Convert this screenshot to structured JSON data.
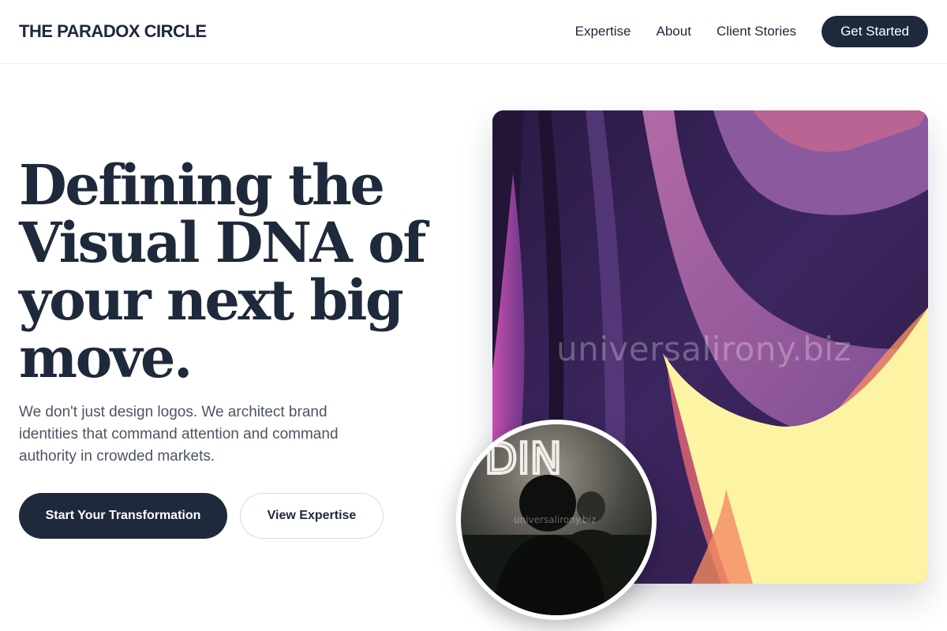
{
  "header": {
    "brand": "THE PARADOX CIRCLE",
    "nav": [
      {
        "label": "Expertise"
      },
      {
        "label": "About"
      },
      {
        "label": "Client Stories"
      }
    ],
    "cta_label": "Get Started"
  },
  "hero": {
    "title": "Defining the Visual DNA of your next big move.",
    "subtitle": "We don't just design logos. We architect brand identities that command attention and command authority in crowded markets.",
    "primary_button": "Start Your Transformation",
    "secondary_button": "View Expertise"
  },
  "media": {
    "watermark_large": "universalirony.biz",
    "watermark_small": "universalirony.biz",
    "photo_lettering": "DIN"
  },
  "colors": {
    "primary": "#1e293b",
    "text_muted": "#4b5563",
    "border": "#d7dbe0",
    "art_purple": "#3b2456",
    "art_yellow": "#fdf4a3"
  }
}
